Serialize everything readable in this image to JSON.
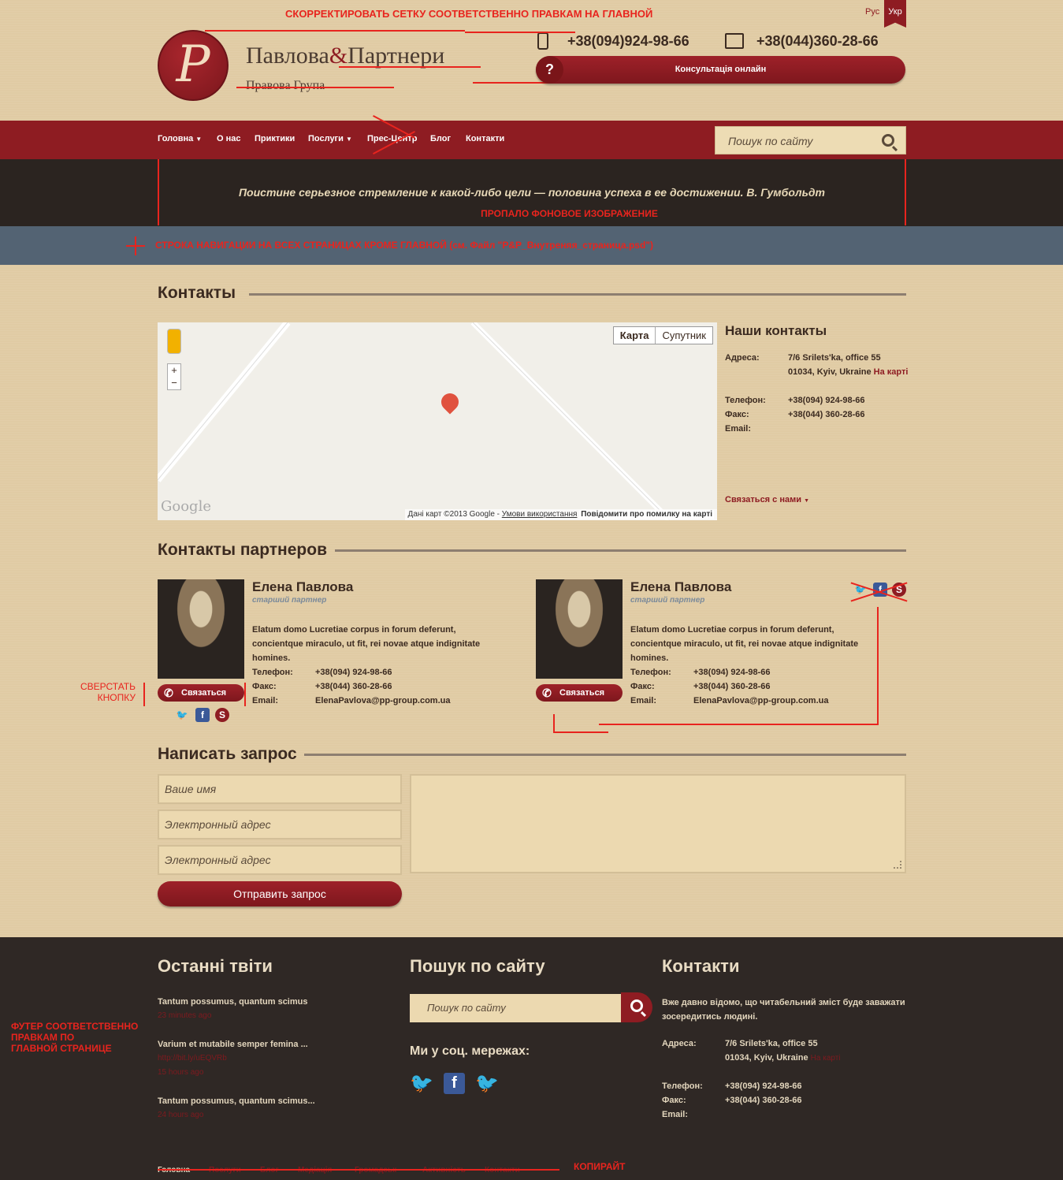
{
  "annotations": {
    "top_note": "СКОРРЕКТИРОВАТЬ СЕТКУ СООТВЕТСТВЕННО ПРАВКАМ НА ГЛАВНОЙ",
    "bg_missing": "ПРОПАЛО ФОНОВОЕ ИЗОБРАЖЕНИЕ",
    "nav_row": "СТРОКА НАВИГАЦИИ НА ВСЕХ СТРАНИЦАХ КРОМЕ ГЛАВНОЙ (см. Файл \"P&P_Внутреняя_страница.psd\")",
    "build_button": "СВЕРСТАТЬ\nКНОПКУ",
    "footer_note": "ФУТЕР СООТВЕТСТВЕННО\nПРАВКАМ ПО\nГЛАВНОЙ СТРАНИЦЕ",
    "copyright": "КОПИРАЙТ"
  },
  "lang": {
    "rus": "Рус",
    "ukr": "Укр"
  },
  "header": {
    "logo_letter": "P",
    "brand_left": "Павлова",
    "brand_amp": "&",
    "brand_right": "Партнери",
    "brand_sub": "Правова Група",
    "phone1": "+38(094)924-98-66",
    "phone2": "+38(044)360-28-66",
    "consult": "Консультація онлайн"
  },
  "nav": {
    "home": "Головна",
    "about": "О нас",
    "practices": "Приктики",
    "services": "Послуги",
    "press": "Прес-Центр",
    "blog": "Блог",
    "contacts": "Контакти",
    "search_placeholder": "Пошук по сайту"
  },
  "quote": "Поистине серьезное стремление к какой-либо цели — половина успеха в ее достижении. В. Гумбольдт",
  "contacts_section": {
    "title": "Контакты",
    "map_tab_map": "Карта",
    "map_tab_sat": "Супутник",
    "map_footer_data": "Дані карт ©2013 Google - ",
    "map_footer_terms": "Умови використання",
    "map_footer_report": "Повідомити про помилку на карті",
    "google": "Google",
    "our_contacts": "Наши контакты",
    "address_label": "Адреса:",
    "address_line1": "7/6 Srilets'ka, office 55",
    "address_line2": "01034, Kyiv, Ukraine",
    "on_map": "На карті",
    "phone_label": "Телефон:",
    "phone_value": "+38(094) 924-98-66",
    "fax_label": "Факс:",
    "fax_value": "+38(044) 360-28-66",
    "email_label": "Email:",
    "contact_us": "Связаться с нами"
  },
  "partners_section": {
    "title": "Контакты партнеров",
    "partners": [
      {
        "name": "Елена Павлова",
        "role": "старший партнер",
        "desc": "Elatum domo Lucretiae corpus in forum deferunt, concientque miraculo, ut fit, rei novae atque indignitate homines.",
        "phone_label": "Телефон:",
        "phone": "+38(094) 924-98-66",
        "fax_label": "Факс:",
        "fax": "+38(044) 360-28-66",
        "email_label": "Email:",
        "email": "ElenaPavlova@pp-group.com.ua",
        "button": "Связаться"
      },
      {
        "name": "Елена Павлова",
        "role": "старший партнер",
        "desc": "Elatum domo Lucretiae corpus in forum deferunt, concientque miraculo, ut fit, rei novae atque indignitate homines.",
        "phone_label": "Телефон:",
        "phone": "+38(094) 924-98-66",
        "fax_label": "Факс:",
        "fax": "+38(044) 360-28-66",
        "email_label": "Email:",
        "email": "ElenaPavlova@pp-group.com.ua",
        "button": "Связаться"
      }
    ]
  },
  "form_section": {
    "title": "Написать запрос",
    "name_placeholder": "Ваше имя",
    "email_placeholder": "Электронный адрес",
    "email2_placeholder": "Электронный адрес",
    "submit": "Отправить запрос"
  },
  "footer": {
    "tweets_title": "Останні твіти",
    "tweets": [
      {
        "text": "Tantum possumus, quantum scimus",
        "link": "",
        "time": "23 minutes ago"
      },
      {
        "text": "Varium et mutabile semper femina ...",
        "link": "http://bit.ly/uEQVRb",
        "time": "15 hours ago"
      },
      {
        "text": "Tantum possumus, quantum scimus...",
        "link": "",
        "time": "24 hours ago"
      }
    ],
    "search_title": "Пошук по сайту",
    "search_placeholder": "Пошук по сайту",
    "social_title": "Ми у соц. мережах:",
    "contacts_title": "Контакти",
    "contacts_text": "Вже давно відомо, що читабельний зміст буде заважати зосередитись людині.",
    "address_label": "Адреса:",
    "address_line1": "7/6 Srilets'ka, office 55",
    "address_line2": "01034, Kyiv, Ukraine",
    "on_map": "На карті",
    "phone_label": "Телефон:",
    "phone_value": "+38(094) 924-98-66",
    "fax_label": "Факс:",
    "fax_value": "+38(044) 360-28-66",
    "email_label": "Email:",
    "nav": [
      "Головна",
      "Послуги",
      "Блог",
      "Медіація",
      "Громадськ",
      "Активність",
      "Контакти"
    ]
  },
  "colors": {
    "brand_red": "#8e1c22",
    "annotation_red": "#e8241e",
    "bg_tan": "#e0cba4",
    "footer_dark": "#2f2825"
  }
}
